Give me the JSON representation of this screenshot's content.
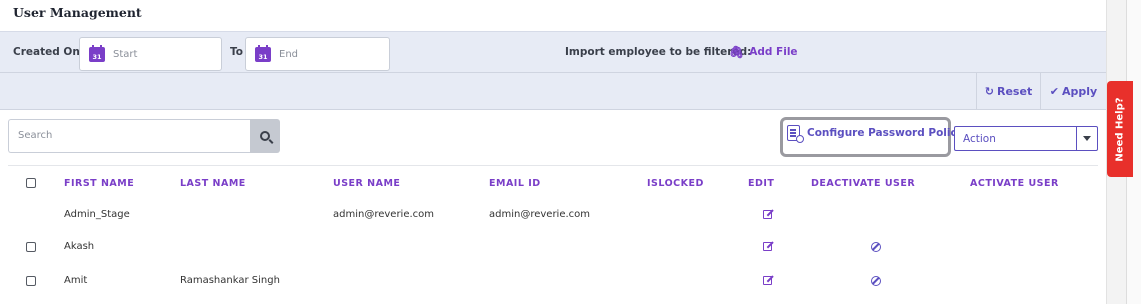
{
  "page": {
    "title": "User Management"
  },
  "filters": {
    "created_on_label": "Created On:",
    "start_placeholder": "Start",
    "to_label": "To",
    "end_placeholder": "End",
    "calendar_day": "31",
    "import_label": "Import employee to be filtered:",
    "add_file_label": "Add File",
    "reset_label": "Reset",
    "apply_label": "Apply"
  },
  "toolbar": {
    "search_placeholder": "Search",
    "configure_label": "Configure Password Policy",
    "action_label": "Action"
  },
  "table": {
    "headers": [
      "FIRST NAME",
      "LAST NAME",
      "USER NAME",
      "EMAIL ID",
      "ISLOCKED",
      "EDIT",
      "DEACTIVATE USER",
      "ACTIVATE USER"
    ],
    "rows": [
      {
        "first_name": "Admin_Stage",
        "last_name": "",
        "user_name": "admin@reverie.com",
        "email": "admin@reverie.com",
        "has_checkbox": false,
        "has_deactivate": false
      },
      {
        "first_name": "Akash",
        "last_name": "",
        "user_name": "",
        "email": "",
        "has_checkbox": true,
        "has_deactivate": true
      },
      {
        "first_name": "Amit",
        "last_name": "Ramashankar Singh",
        "user_name": "",
        "email": "",
        "has_checkbox": true,
        "has_deactivate": true
      }
    ]
  },
  "help": {
    "label": "Need Help?"
  },
  "colors": {
    "accent": "#7a3ec8",
    "button_text": "#5b4fc0",
    "filter_bg": "#e7ebf5",
    "help_bg": "#e8302b"
  },
  "icons": {
    "calendar": "calendar-icon",
    "attach": "paperclip-icon",
    "reset": "refresh-icon",
    "apply": "check-circle-icon",
    "search": "search-icon",
    "configure": "document-settings-icon",
    "edit": "edit-icon",
    "deactivate": "ban-icon"
  }
}
